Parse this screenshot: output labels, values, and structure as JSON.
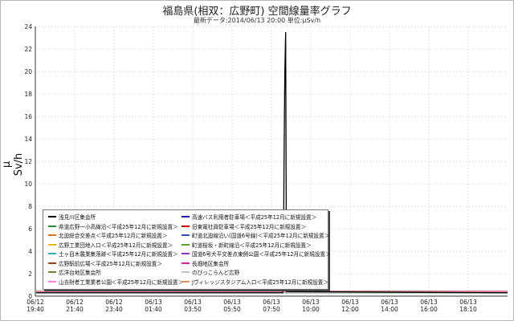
{
  "chart_data": {
    "type": "line",
    "title": "福島県(相双：広野町) 空間線量率グラフ",
    "subtitle": "最新データ:2014/06/13 20:00 単位:μSv/h",
    "ylabel": "μ Sv/h",
    "xlabel": "",
    "ylim": [
      0,
      24
    ],
    "y_ticks": [
      "0",
      "2",
      "4",
      "6",
      "8",
      "10",
      "12",
      "14",
      "16",
      "18",
      "20",
      "22",
      "24"
    ],
    "x_ticks": [
      {
        "date": "06/12",
        "time": "19:40"
      },
      {
        "date": "06/12",
        "time": "21:40"
      },
      {
        "date": "06/12",
        "time": "23:40"
      },
      {
        "date": "06/13",
        "time": "01:40"
      },
      {
        "date": "06/13",
        "time": "03:50"
      },
      {
        "date": "06/13",
        "time": "05:50"
      },
      {
        "date": "06/13",
        "time": "07:50"
      },
      {
        "date": "06/13",
        "time": "10:00"
      },
      {
        "date": "06/13",
        "time": "12:00"
      },
      {
        "date": "06/13",
        "time": "14:00"
      },
      {
        "date": "06/13",
        "time": "16:00"
      },
      {
        "date": "06/13",
        "time": "18:10"
      }
    ],
    "grid": true,
    "legend_position": "bottom-left",
    "spike": {
      "series": "浅見川区集会所",
      "time": "06/13 08:50",
      "value": 23.5
    },
    "baseline_value": 0.3,
    "series": [
      {
        "name": "浅見川区集会所",
        "color": "#000000"
      },
      {
        "name": "高速バス利用者駐車場＜平成25年12月に新規設置＞",
        "color": "#1a1aa8"
      },
      {
        "name": "県道広野一小高線沿＜平成25年12月に新規設置＞",
        "color": "#2e8b2e"
      },
      {
        "name": "旧東電社員駐車場＜平成25年12月に新規設置＞",
        "color": "#cc0000"
      },
      {
        "name": "北迫総合交差点＜平成25年12月に新規設置＞",
        "color": "#e07020"
      },
      {
        "name": "町道北迫線沿い(国道6号線)＜平成25年12月に新規設置＞",
        "color": "#2f4fb0"
      },
      {
        "name": "広野工業団地入口＜平成25年12月に新規設置＞",
        "color": "#e6b800"
      },
      {
        "name": "町道桜坂・新町線沿＜平成25年12月に新規設置＞",
        "color": "#55aa22"
      },
      {
        "name": "土ヶ目木農業集落跡＜平成25年12月に新規設置＞",
        "color": "#30b0b0"
      },
      {
        "name": "国道6号大平交差点東側公園＜平成25年12月に新規設置＞",
        "color": "#9030c0"
      },
      {
        "name": "広野駅前広場＜平成25年12月に新規設置＞",
        "color": "#a04010"
      },
      {
        "name": "長畑地区集会所",
        "color": "#d020a0"
      },
      {
        "name": "広洋台地区集会所",
        "color": "#708030"
      },
      {
        "name": "のびっこらんど広野",
        "color": "#c0c0c0"
      },
      {
        "name": "山去財者工業業者公園＜平成25年12月に新規設置＞",
        "color": "#ff80e0"
      },
      {
        "name": "Jヴィレッジスタジアム入口＜平成25年12月に新規設置＞",
        "color": "#d89060"
      }
    ]
  }
}
